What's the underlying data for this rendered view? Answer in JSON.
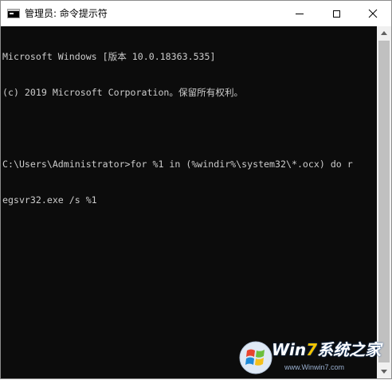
{
  "window": {
    "title": "管理员: 命令提示符",
    "buttons": {
      "minimize": "minimize",
      "maximize": "maximize",
      "close": "close"
    }
  },
  "console": {
    "lines": [
      "Microsoft Windows [版本 10.0.18363.535]",
      "(c) 2019 Microsoft Corporation。保留所有权利。",
      "",
      "C:\\Users\\Administrator>for %1 in (%windir%\\system32\\*.ocx) do r",
      "egsvr32.exe /s %1"
    ],
    "background": "#0c0c0c",
    "foreground": "#cccccc"
  },
  "watermark": {
    "brand_prefix": "Win",
    "brand_number": "7",
    "brand_suffix": "系统之家",
    "site": "www.Winwin7.com"
  },
  "icons": {
    "app": "cmd-icon",
    "logo": "windows-logo-icon"
  }
}
